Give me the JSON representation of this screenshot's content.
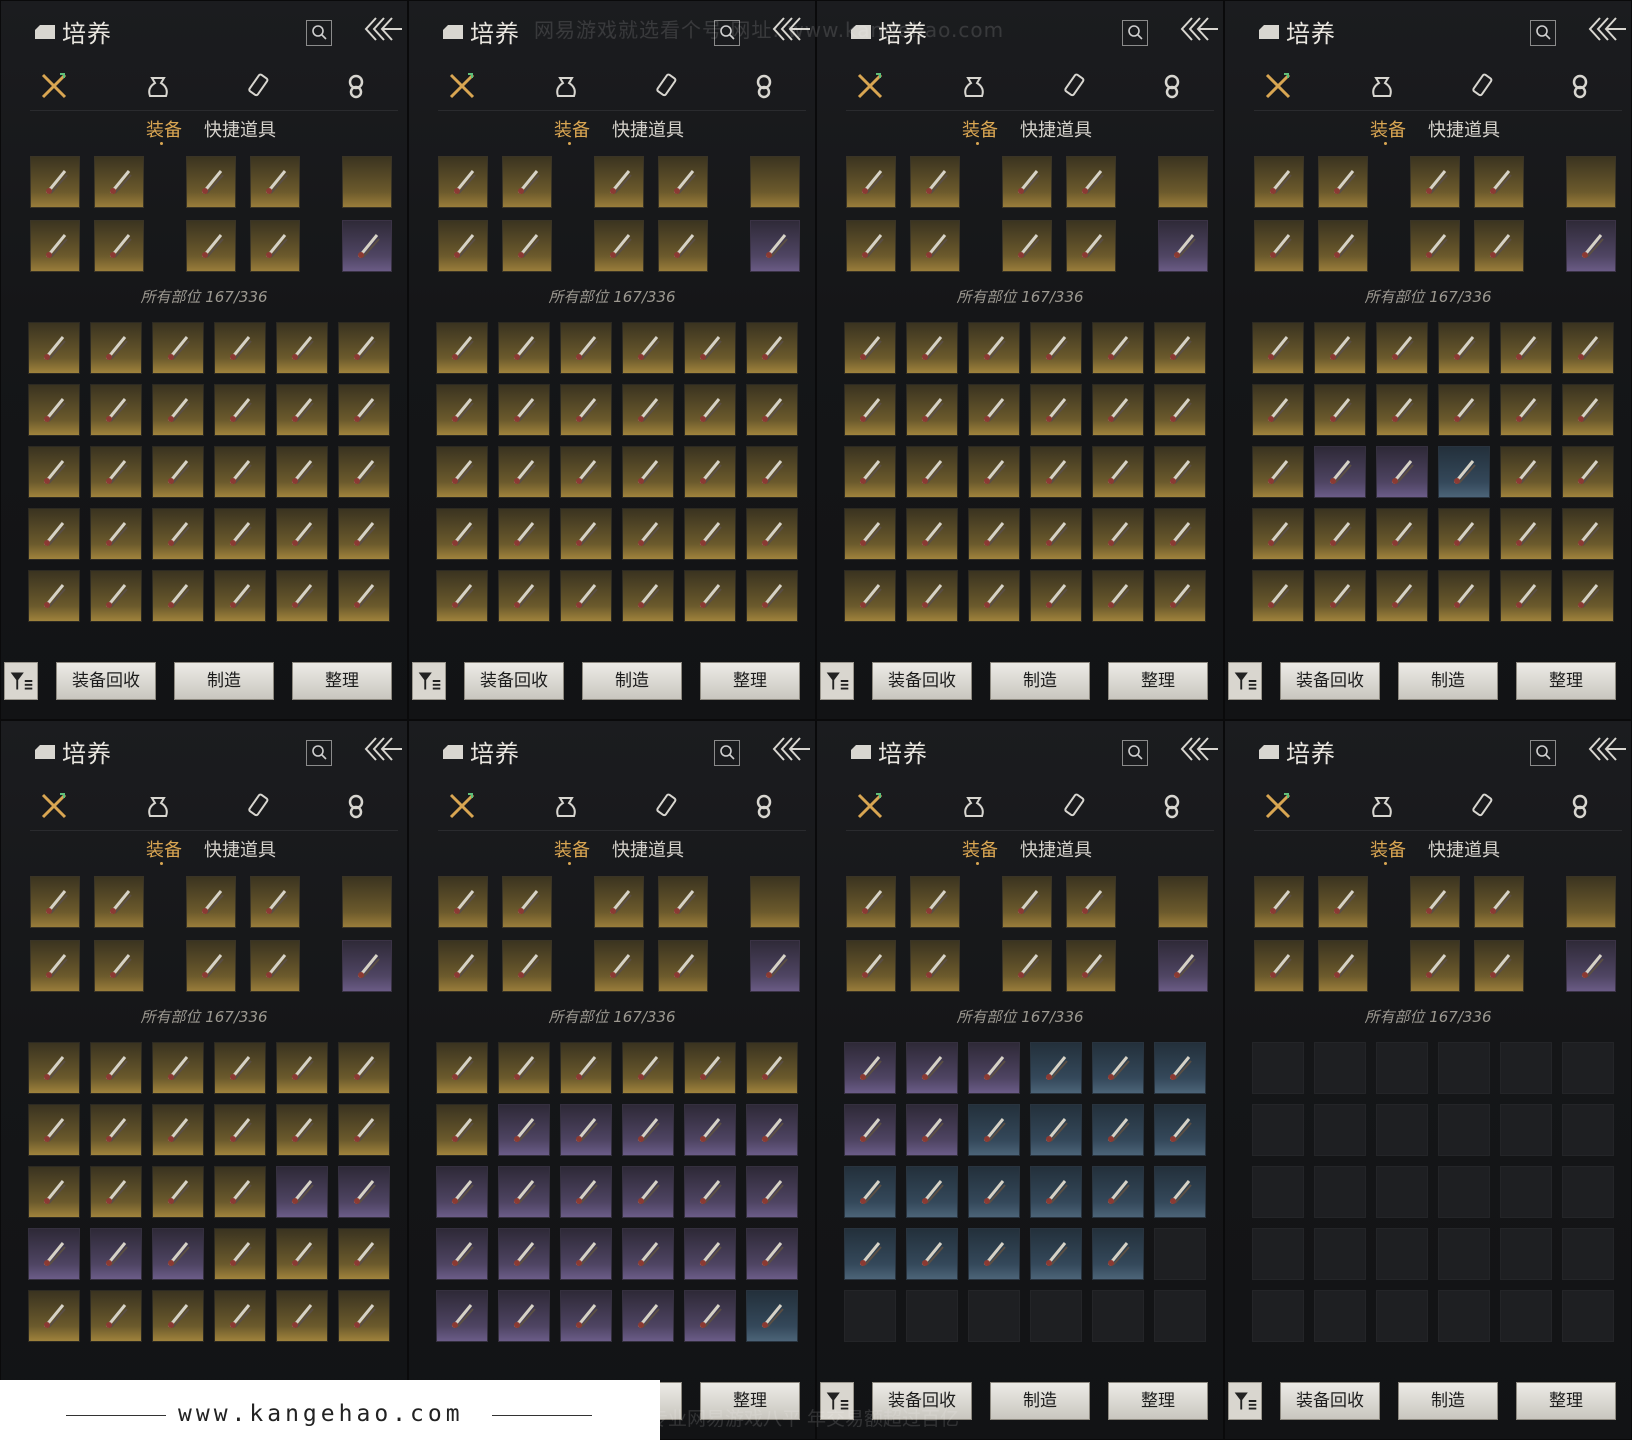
{
  "panel": {
    "title": "培养",
    "tabs": {
      "equip": "装备",
      "quick": "快捷道具"
    },
    "count_text": "所有部位 167/336",
    "buttons": {
      "recycle": "装备回收",
      "craft": "制造",
      "organize": "整理"
    },
    "categories": [
      "crossed-swords-icon",
      "pouch-icon",
      "scroll-icon",
      "token-icon"
    ]
  },
  "watermarks": {
    "top": "网易游戏就选看个号 网址: www.kangehao.com",
    "site": "www.kangehao.com",
    "bottom": "看个号专业网易游戏八平 年交易额超过百亿"
  },
  "colors": {
    "accent": "#d9a652",
    "gold_slot": "#9a7d3a",
    "purple_slot": "#6a5b85",
    "blue_slot": "#4c6478"
  },
  "equipped_slots": [
    "gold",
    "gold",
    "gold",
    "gold",
    "gold",
    "gold",
    "gold",
    "gold",
    "gold",
    "gold",
    "gold",
    "purple"
  ],
  "pages": [
    {
      "rows": [
        [
          "gold",
          "gold",
          "gold",
          "gold",
          "gold",
          "gold"
        ],
        [
          "gold",
          "gold",
          "gold",
          "gold",
          "gold",
          "gold"
        ],
        [
          "gold",
          "gold",
          "gold",
          "gold",
          "gold",
          "gold"
        ],
        [
          "gold",
          "gold",
          "gold",
          "gold",
          "gold",
          "gold"
        ],
        [
          "gold",
          "gold",
          "gold",
          "gold",
          "gold",
          "gold"
        ]
      ]
    },
    {
      "rows": [
        [
          "gold",
          "gold",
          "gold",
          "gold",
          "gold",
          "gold"
        ],
        [
          "gold",
          "gold",
          "gold",
          "gold",
          "gold",
          "gold"
        ],
        [
          "gold",
          "gold",
          "gold",
          "gold",
          "gold",
          "gold"
        ],
        [
          "gold",
          "gold",
          "gold",
          "gold",
          "gold",
          "gold"
        ],
        [
          "gold",
          "gold",
          "gold",
          "gold",
          "gold",
          "gold"
        ]
      ]
    },
    {
      "rows": [
        [
          "gold",
          "gold",
          "gold",
          "gold",
          "gold",
          "gold"
        ],
        [
          "gold",
          "gold",
          "gold",
          "gold",
          "gold",
          "gold"
        ],
        [
          "gold",
          "gold",
          "gold",
          "gold",
          "gold",
          "gold"
        ],
        [
          "gold",
          "gold",
          "gold",
          "gold",
          "gold",
          "gold"
        ],
        [
          "gold",
          "gold",
          "gold",
          "gold",
          "gold",
          "gold"
        ]
      ]
    },
    {
      "rows": [
        [
          "gold",
          "gold",
          "gold",
          "gold",
          "gold",
          "gold"
        ],
        [
          "gold",
          "gold",
          "gold",
          "gold",
          "gold",
          "gold"
        ],
        [
          "gold",
          "purple",
          "purple",
          "blue",
          "gold",
          "gold"
        ],
        [
          "gold",
          "gold",
          "gold",
          "gold",
          "gold",
          "gold"
        ],
        [
          "gold",
          "gold",
          "gold",
          "gold",
          "gold",
          "gold"
        ]
      ]
    },
    {
      "rows": [
        [
          "gold",
          "gold",
          "gold",
          "gold",
          "gold",
          "gold"
        ],
        [
          "gold",
          "gold",
          "gold",
          "gold",
          "gold",
          "gold"
        ],
        [
          "gold",
          "gold",
          "gold",
          "gold",
          "purple",
          "purple"
        ],
        [
          "purple",
          "purple",
          "purple",
          "gold",
          "gold",
          "gold"
        ],
        [
          "gold",
          "gold",
          "gold",
          "gold",
          "gold",
          "gold"
        ]
      ]
    },
    {
      "rows": [
        [
          "gold",
          "gold",
          "gold",
          "gold",
          "gold",
          "gold"
        ],
        [
          "gold",
          "purple",
          "purple",
          "purple",
          "purple",
          "purple"
        ],
        [
          "purple",
          "purple",
          "purple",
          "purple",
          "purple",
          "purple"
        ],
        [
          "purple",
          "purple",
          "purple",
          "purple",
          "purple",
          "purple"
        ],
        [
          "purple",
          "purple",
          "purple",
          "purple",
          "purple",
          "blue"
        ]
      ]
    },
    {
      "rows": [
        [
          "purple",
          "purple",
          "purple",
          "blue",
          "blue",
          "blue"
        ],
        [
          "purple",
          "purple",
          "blue",
          "blue",
          "blue",
          "blue"
        ],
        [
          "blue",
          "blue",
          "blue",
          "blue",
          "blue",
          "blue"
        ],
        [
          "blue",
          "blue",
          "blue",
          "blue",
          "blue",
          "empty"
        ],
        [
          "empty",
          "empty",
          "empty",
          "empty",
          "empty",
          "empty"
        ]
      ]
    },
    {
      "rows": [
        [
          "empty",
          "empty",
          "empty",
          "empty",
          "empty",
          "empty"
        ],
        [
          "empty",
          "empty",
          "empty",
          "empty",
          "empty",
          "empty"
        ],
        [
          "empty",
          "empty",
          "empty",
          "empty",
          "empty",
          "empty"
        ],
        [
          "empty",
          "empty",
          "empty",
          "empty",
          "empty",
          "empty"
        ],
        [
          "empty",
          "empty",
          "empty",
          "empty",
          "empty",
          "empty"
        ]
      ]
    }
  ]
}
